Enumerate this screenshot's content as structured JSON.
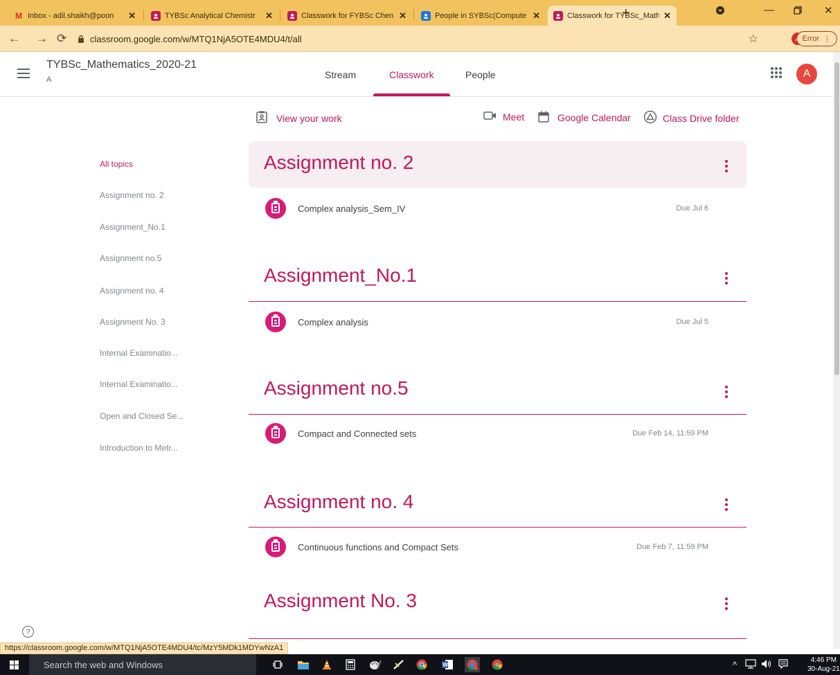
{
  "browser": {
    "tabs": [
      {
        "label": "Inbox - adil.shaikh@poon",
        "icon": "gmail-icon"
      },
      {
        "label": "TYBSc Analytical Chemistr",
        "icon": "classroom-icon"
      },
      {
        "label": "Classwork for FYBSc Chen",
        "icon": "classroom-icon"
      },
      {
        "label": "People in SYBSc(Compute",
        "icon": "classroom-icon"
      },
      {
        "label": "Classwork for TYBSc_Math",
        "icon": "classroom-icon"
      }
    ],
    "url": "classroom.google.com/w/MTQ1NjA5OTE4MDU4/t/all",
    "profile_initial": "A",
    "error_label": "Error",
    "status_url": "https://classroom.google.com/w/MTQ1NjA5OTE4MDU4/tc/MzY5MDk1MDYwNzA1"
  },
  "header": {
    "class_name": "TYBSc_Mathematics_2020-21",
    "section": "A",
    "tabs": {
      "stream": "Stream",
      "classwork": "Classwork",
      "people": "People"
    },
    "avatar_initial": "A"
  },
  "actions": {
    "view_work": "View your work",
    "meet": "Meet",
    "calendar": "Google Calendar",
    "drive": "Class Drive folder"
  },
  "topics": [
    "All topics",
    "Assignment no. 2",
    "Assignment_No.1",
    "Assignment no.5",
    "Assignment no. 4",
    "Assignment No. 3",
    "Internal Examinatio...",
    "Internal Examinatio...",
    "Open and Closed Se...",
    "Introduction to Metr..."
  ],
  "sections": [
    {
      "title": "Assignment no. 2",
      "item": "Complex analysis_Sem_IV",
      "due": "Due Jul 6"
    },
    {
      "title": "Assignment_No.1",
      "item": "Complex analysis",
      "due": "Due Jul 5"
    },
    {
      "title": "Assignment no.5",
      "item": "Compact and Connected sets",
      "due": "Due Feb 14, 11:59 PM"
    },
    {
      "title": "Assignment no. 4",
      "item": "Continuous functions and Compact Sets",
      "due": "Due Feb 7, 11:59 PM"
    },
    {
      "title": "Assignment No. 3"
    }
  ],
  "taskbar": {
    "search_placeholder": "Search the web and Windows",
    "time": "4:46 PM",
    "date": "30-Aug-21"
  },
  "colors": {
    "accent": "#c2185b",
    "tabstrip": "#f2c25f",
    "toolbar": "#fbe3b4"
  }
}
